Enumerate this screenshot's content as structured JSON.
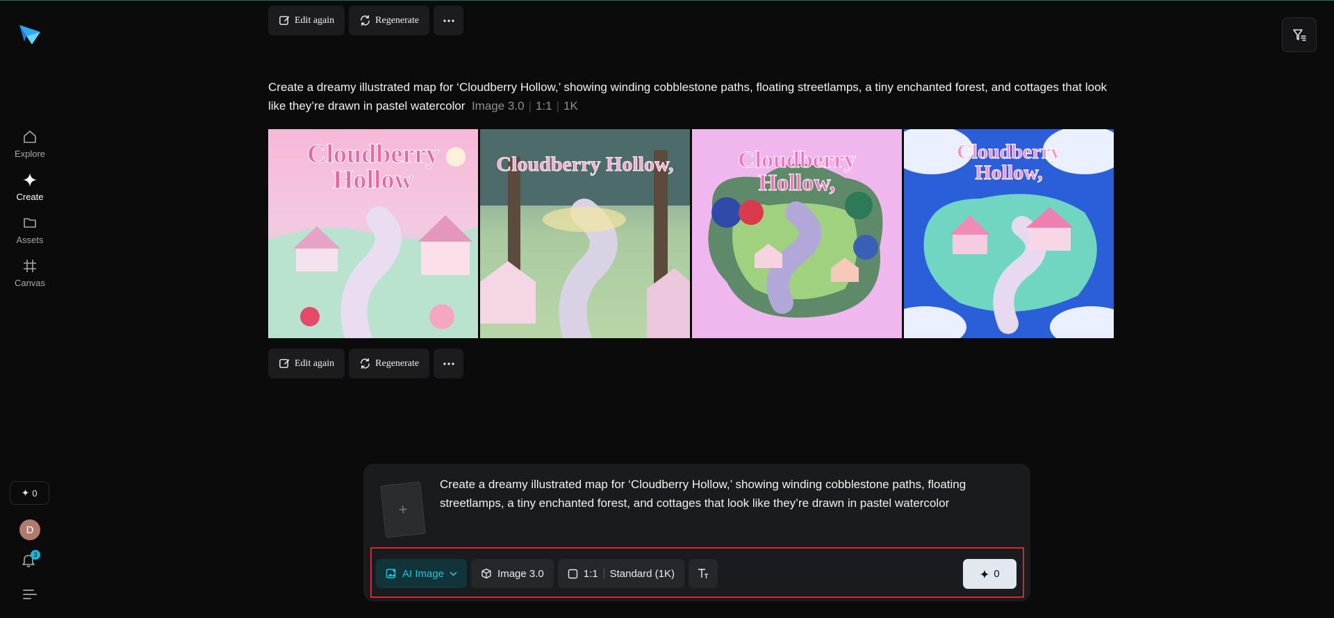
{
  "sidebar": {
    "nav": [
      {
        "label": "Explore",
        "icon": "home-icon"
      },
      {
        "label": "Create",
        "icon": "sparkle-icon"
      },
      {
        "label": "Assets",
        "icon": "folder-icon"
      },
      {
        "label": "Canvas",
        "icon": "frame-icon"
      }
    ],
    "credits": "0",
    "avatar_initial": "D",
    "notifications": "3"
  },
  "actions": {
    "edit_label": "Edit again",
    "regenerate_label": "Regenerate"
  },
  "prompt": {
    "text": "Create a dreamy illustrated map for ‘Cloudberry Hollow,’ showing winding cobblestone paths, floating streetlamps, a tiny enchanted forest, and cottages that look like they’re drawn in pastel watercolor",
    "model": "Image 3.0",
    "ratio": "1:1",
    "resolution": "1K"
  },
  "images": [
    {
      "title_line1": "Cloudberry",
      "title_line2": "Hollow"
    },
    {
      "title_line1": "Cloudberry Hollow,",
      "title_line2": ""
    },
    {
      "title_line1": "Cloudberry",
      "title_line2": "Hollow,"
    },
    {
      "title_line1": "Cloudberry",
      "title_line2": "Hollow,"
    }
  ],
  "composer": {
    "text": "Create a dreamy illustrated map for ‘Cloudberry Hollow,’ showing winding cobblestone paths, floating streetlamps, a tiny enchanted forest, and cottages that look like they’re drawn in pastel watercolor",
    "upload_plus": "+",
    "mode_label": "AI Image",
    "model_label": "Image 3.0",
    "ratio_label": "1:1",
    "quality_label": "Standard (1K)",
    "send_count": "0"
  },
  "colors": {
    "accent": "#22c3df",
    "highlight": "#e0242b",
    "background": "#0b0b0c"
  }
}
